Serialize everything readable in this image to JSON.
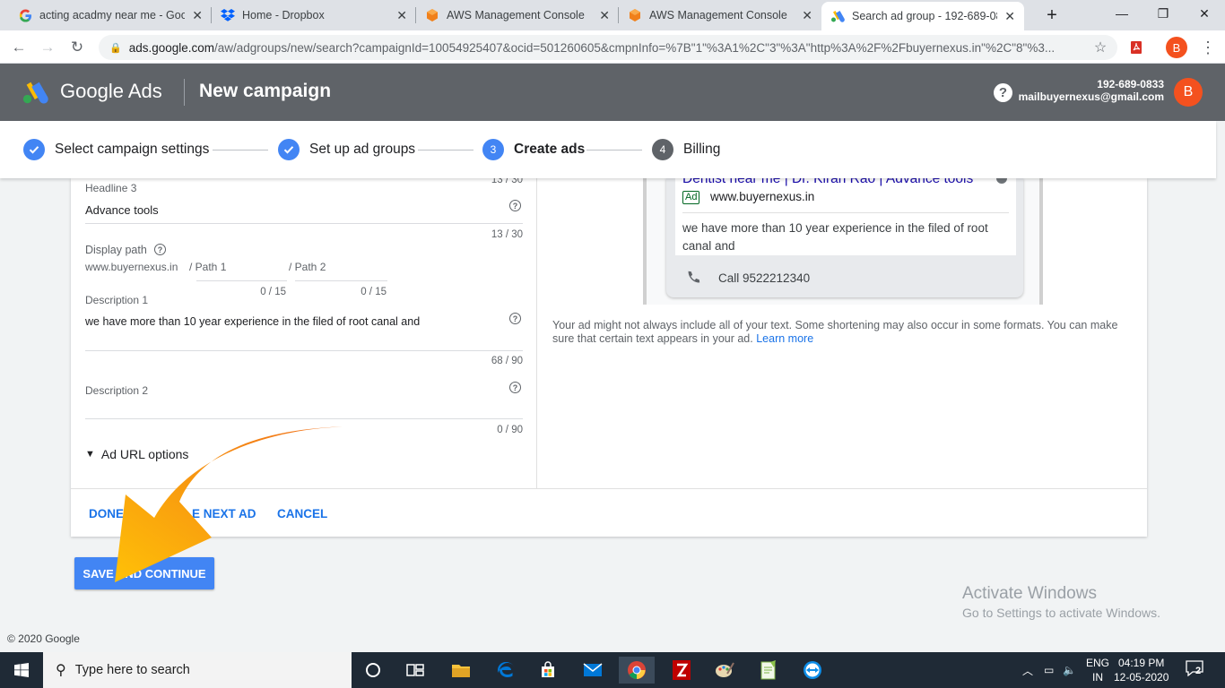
{
  "browser": {
    "tabs": [
      {
        "title": "acting acadmy near me - Goog",
        "icon": "google-icon"
      },
      {
        "title": "Home - Dropbox",
        "icon": "dropbox-icon"
      },
      {
        "title": "AWS Management Console",
        "icon": "aws-icon"
      },
      {
        "title": "AWS Management Console",
        "icon": "aws-icon"
      },
      {
        "title": "Search ad group - 192-689-08",
        "icon": "google-ads-icon"
      }
    ],
    "url_host": "ads.google.com",
    "url_rest": "/aw/adgroups/new/search?campaignId=10054925407&ocid=501260605&cmpnInfo=%7B\"1\"%3A1%2C\"3\"%3A\"http%3A%2F%2Fbuyernexus.in\"%2C\"8\"%3...",
    "profile_initial": "B"
  },
  "header": {
    "product": "Google Ads",
    "page_title": "New campaign",
    "account_id": "192-689-0833",
    "account_email": "mailbuyernexus@gmail.com",
    "avatar_initial": "B"
  },
  "stepper": {
    "steps": [
      {
        "number": "",
        "label": "Select campaign settings"
      },
      {
        "number": "",
        "label": "Set up ad groups"
      },
      {
        "number": "3",
        "label": "Create ads"
      },
      {
        "number": "4",
        "label": "Billing"
      }
    ]
  },
  "form": {
    "headline3_count_top": "13 / 30",
    "headline3_label": "Headline 3",
    "headline3_value": "Advance tools",
    "headline3_count": "13 / 30",
    "display_path_label": "Display path",
    "display_path_domain": "www.buyernexus.in",
    "path1_placeholder": "/ Path 1",
    "path2_placeholder": "/ Path 2",
    "path1_count": "0 / 15",
    "path2_count": "0 / 15",
    "description1_label": "Description 1",
    "description1_value": "we have more than 10 year experience in the filed of root canal  and",
    "description1_count": "68 / 90",
    "description2_label": "Description 2",
    "description2_count": "0 / 90",
    "url_options_label": "Ad URL options"
  },
  "footer_buttons": {
    "done": "DONE A",
    "next_ad": "E NEXT AD",
    "cancel": "CANCEL"
  },
  "preview": {
    "headline": "Dentist near me | Dr. Kiran Rao | Advance tools",
    "badge": "Ad",
    "display_url": "www.buyernexus.in",
    "description": "we have more than 10 year experience in the filed of root canal and",
    "call_text": "Call 9522212340",
    "note": "Your ad might not always include all of your text. Some shortening may also occur in some formats. You can make sure that certain text appears in your ad.",
    "learn_more": "Learn more"
  },
  "save_button": "SAVE AND CONTINUE",
  "copyright": "© 2020 Google",
  "activate": {
    "title": "Activate Windows",
    "subtitle": "Go to Settings to activate Windows."
  },
  "taskbar": {
    "search_placeholder": "Type here to search",
    "lang_line1": "ENG",
    "lang_line2": "IN",
    "time": "04:19 PM",
    "date": "12-05-2020",
    "notifications": "2"
  },
  "colors": {
    "accent_blue": "#4285f4",
    "link_blue": "#1a73e8",
    "header_grey": "#5f6368",
    "avatar_orange": "#f4511e",
    "arrow_orange": "#f28a1e"
  }
}
